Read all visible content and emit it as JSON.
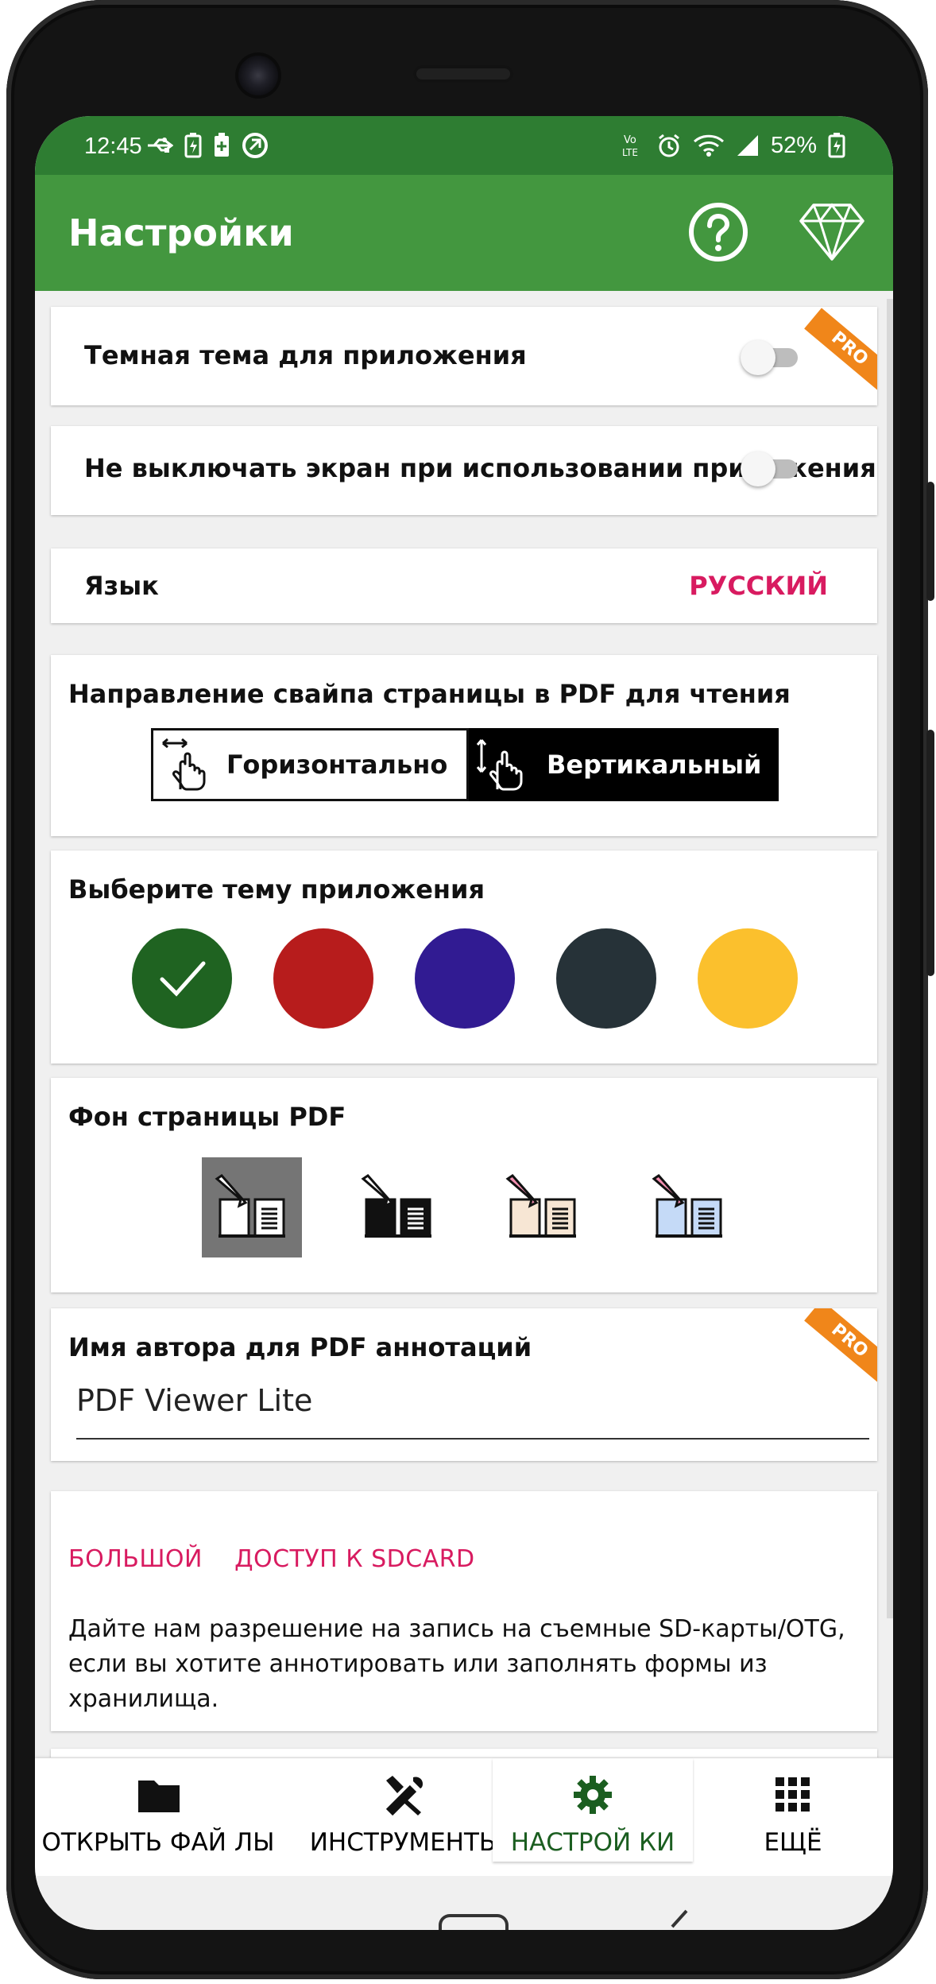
{
  "status_bar": {
    "time": "12:45",
    "battery_percent": "52%"
  },
  "app_bar": {
    "title": "Настройки",
    "help_icon": "help-circle-icon",
    "premium_icon": "diamond-icon"
  },
  "settings": {
    "dark_theme": {
      "label": "Темная тема для приложения",
      "enabled": false,
      "badge": "PRO"
    },
    "keep_screen_on": {
      "label": "Не выключать экран при использовании приложения",
      "enabled": false
    },
    "language": {
      "label": "Язык",
      "value": "РУССКИЙ"
    },
    "swipe_direction": {
      "label": "Направление свайпа страницы в PDF для чтения",
      "options": [
        "Горизонтально",
        "Вертикальный"
      ],
      "selected": "Вертикальный"
    },
    "app_theme": {
      "label": "Выберите тему приложения",
      "colors": [
        "#1f6321",
        "#b71c1c",
        "#311b92",
        "#263238",
        "#fbc02d"
      ],
      "selected_index": 0
    },
    "pdf_background": {
      "label": "Фон страницы PDF",
      "options": [
        "grey",
        "black",
        "sepia",
        "blue"
      ],
      "selected_index": 0
    },
    "author_name": {
      "label": "Имя автора для PDF аннотаций",
      "value": "PDF Viewer Lite",
      "badge": "PRO"
    },
    "sdcard": {
      "title_1": "БОЛЬШОЙ",
      "title_2": "ДОСТУП К SDCARD",
      "description": "Дайте нам разрешение на запись на съемные SD-карты/OTG, если вы хотите аннотировать или заполнять формы из хранилища."
    }
  },
  "bottom_nav": {
    "tabs": [
      {
        "label": "ОТКРЫТЬ ФАЙ ЛЫ",
        "icon": "folder-icon"
      },
      {
        "label": "ИНСТРУМЕНТЫ",
        "icon": "tools-icon"
      },
      {
        "label": "НАСТРОЙ КИ",
        "icon": "gear-icon"
      },
      {
        "label": "ЕЩЁ",
        "icon": "grid-icon"
      }
    ],
    "active_index": 2,
    "active_color": "#1b5e20"
  },
  "colors": {
    "status_bar": "#2e7d32",
    "app_bar": "#43973f",
    "accent": "#d81b60",
    "pro_badge": "#f0861a"
  }
}
